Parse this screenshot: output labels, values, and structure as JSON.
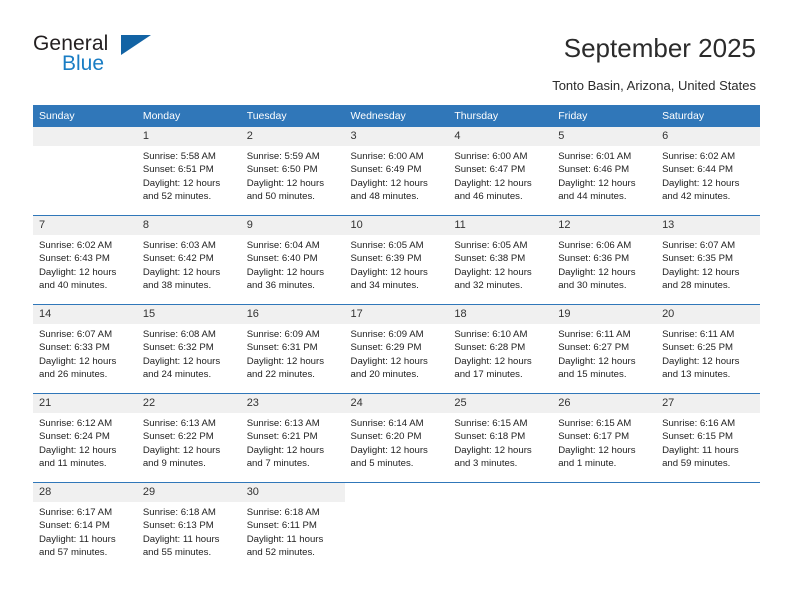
{
  "brand": {
    "name_top": "General",
    "name_bottom": "Blue",
    "triangle_color": "#1263a4",
    "blue": "#1a7dc4"
  },
  "header": {
    "title": "September 2025",
    "subtitle": "Tonto Basin, Arizona, United States"
  },
  "theme": {
    "header_row_bg": "#3077b9",
    "daynum_bg": "#f0f0f0",
    "grid_line": "#3077b9"
  },
  "weekday_headers": [
    "Sunday",
    "Monday",
    "Tuesday",
    "Wednesday",
    "Thursday",
    "Friday",
    "Saturday"
  ],
  "weeks": [
    [
      {
        "day": "",
        "blank": true,
        "sunrise": "",
        "sunset": "",
        "daylight1": "",
        "daylight2": ""
      },
      {
        "day": "1",
        "sunrise": "Sunrise: 5:58 AM",
        "sunset": "Sunset: 6:51 PM",
        "daylight1": "Daylight: 12 hours",
        "daylight2": "and 52 minutes."
      },
      {
        "day": "2",
        "sunrise": "Sunrise: 5:59 AM",
        "sunset": "Sunset: 6:50 PM",
        "daylight1": "Daylight: 12 hours",
        "daylight2": "and 50 minutes."
      },
      {
        "day": "3",
        "sunrise": "Sunrise: 6:00 AM",
        "sunset": "Sunset: 6:49 PM",
        "daylight1": "Daylight: 12 hours",
        "daylight2": "and 48 minutes."
      },
      {
        "day": "4",
        "sunrise": "Sunrise: 6:00 AM",
        "sunset": "Sunset: 6:47 PM",
        "daylight1": "Daylight: 12 hours",
        "daylight2": "and 46 minutes."
      },
      {
        "day": "5",
        "sunrise": "Sunrise: 6:01 AM",
        "sunset": "Sunset: 6:46 PM",
        "daylight1": "Daylight: 12 hours",
        "daylight2": "and 44 minutes."
      },
      {
        "day": "6",
        "sunrise": "Sunrise: 6:02 AM",
        "sunset": "Sunset: 6:44 PM",
        "daylight1": "Daylight: 12 hours",
        "daylight2": "and 42 minutes."
      }
    ],
    [
      {
        "day": "7",
        "sunrise": "Sunrise: 6:02 AM",
        "sunset": "Sunset: 6:43 PM",
        "daylight1": "Daylight: 12 hours",
        "daylight2": "and 40 minutes."
      },
      {
        "day": "8",
        "sunrise": "Sunrise: 6:03 AM",
        "sunset": "Sunset: 6:42 PM",
        "daylight1": "Daylight: 12 hours",
        "daylight2": "and 38 minutes."
      },
      {
        "day": "9",
        "sunrise": "Sunrise: 6:04 AM",
        "sunset": "Sunset: 6:40 PM",
        "daylight1": "Daylight: 12 hours",
        "daylight2": "and 36 minutes."
      },
      {
        "day": "10",
        "sunrise": "Sunrise: 6:05 AM",
        "sunset": "Sunset: 6:39 PM",
        "daylight1": "Daylight: 12 hours",
        "daylight2": "and 34 minutes."
      },
      {
        "day": "11",
        "sunrise": "Sunrise: 6:05 AM",
        "sunset": "Sunset: 6:38 PM",
        "daylight1": "Daylight: 12 hours",
        "daylight2": "and 32 minutes."
      },
      {
        "day": "12",
        "sunrise": "Sunrise: 6:06 AM",
        "sunset": "Sunset: 6:36 PM",
        "daylight1": "Daylight: 12 hours",
        "daylight2": "and 30 minutes."
      },
      {
        "day": "13",
        "sunrise": "Sunrise: 6:07 AM",
        "sunset": "Sunset: 6:35 PM",
        "daylight1": "Daylight: 12 hours",
        "daylight2": "and 28 minutes."
      }
    ],
    [
      {
        "day": "14",
        "sunrise": "Sunrise: 6:07 AM",
        "sunset": "Sunset: 6:33 PM",
        "daylight1": "Daylight: 12 hours",
        "daylight2": "and 26 minutes."
      },
      {
        "day": "15",
        "sunrise": "Sunrise: 6:08 AM",
        "sunset": "Sunset: 6:32 PM",
        "daylight1": "Daylight: 12 hours",
        "daylight2": "and 24 minutes."
      },
      {
        "day": "16",
        "sunrise": "Sunrise: 6:09 AM",
        "sunset": "Sunset: 6:31 PM",
        "daylight1": "Daylight: 12 hours",
        "daylight2": "and 22 minutes."
      },
      {
        "day": "17",
        "sunrise": "Sunrise: 6:09 AM",
        "sunset": "Sunset: 6:29 PM",
        "daylight1": "Daylight: 12 hours",
        "daylight2": "and 20 minutes."
      },
      {
        "day": "18",
        "sunrise": "Sunrise: 6:10 AM",
        "sunset": "Sunset: 6:28 PM",
        "daylight1": "Daylight: 12 hours",
        "daylight2": "and 17 minutes."
      },
      {
        "day": "19",
        "sunrise": "Sunrise: 6:11 AM",
        "sunset": "Sunset: 6:27 PM",
        "daylight1": "Daylight: 12 hours",
        "daylight2": "and 15 minutes."
      },
      {
        "day": "20",
        "sunrise": "Sunrise: 6:11 AM",
        "sunset": "Sunset: 6:25 PM",
        "daylight1": "Daylight: 12 hours",
        "daylight2": "and 13 minutes."
      }
    ],
    [
      {
        "day": "21",
        "sunrise": "Sunrise: 6:12 AM",
        "sunset": "Sunset: 6:24 PM",
        "daylight1": "Daylight: 12 hours",
        "daylight2": "and 11 minutes."
      },
      {
        "day": "22",
        "sunrise": "Sunrise: 6:13 AM",
        "sunset": "Sunset: 6:22 PM",
        "daylight1": "Daylight: 12 hours",
        "daylight2": "and 9 minutes."
      },
      {
        "day": "23",
        "sunrise": "Sunrise: 6:13 AM",
        "sunset": "Sunset: 6:21 PM",
        "daylight1": "Daylight: 12 hours",
        "daylight2": "and 7 minutes."
      },
      {
        "day": "24",
        "sunrise": "Sunrise: 6:14 AM",
        "sunset": "Sunset: 6:20 PM",
        "daylight1": "Daylight: 12 hours",
        "daylight2": "and 5 minutes."
      },
      {
        "day": "25",
        "sunrise": "Sunrise: 6:15 AM",
        "sunset": "Sunset: 6:18 PM",
        "daylight1": "Daylight: 12 hours",
        "daylight2": "and 3 minutes."
      },
      {
        "day": "26",
        "sunrise": "Sunrise: 6:15 AM",
        "sunset": "Sunset: 6:17 PM",
        "daylight1": "Daylight: 12 hours",
        "daylight2": "and 1 minute."
      },
      {
        "day": "27",
        "sunrise": "Sunrise: 6:16 AM",
        "sunset": "Sunset: 6:15 PM",
        "daylight1": "Daylight: 11 hours",
        "daylight2": "and 59 minutes."
      }
    ],
    [
      {
        "day": "28",
        "sunrise": "Sunrise: 6:17 AM",
        "sunset": "Sunset: 6:14 PM",
        "daylight1": "Daylight: 11 hours",
        "daylight2": "and 57 minutes."
      },
      {
        "day": "29",
        "sunrise": "Sunrise: 6:18 AM",
        "sunset": "Sunset: 6:13 PM",
        "daylight1": "Daylight: 11 hours",
        "daylight2": "and 55 minutes."
      },
      {
        "day": "30",
        "sunrise": "Sunrise: 6:18 AM",
        "sunset": "Sunset: 6:11 PM",
        "daylight1": "Daylight: 11 hours",
        "daylight2": "and 52 minutes."
      },
      {
        "day": "",
        "blank": true,
        "sunrise": "",
        "sunset": "",
        "daylight1": "",
        "daylight2": ""
      },
      {
        "day": "",
        "blank": true,
        "sunrise": "",
        "sunset": "",
        "daylight1": "",
        "daylight2": ""
      },
      {
        "day": "",
        "blank": true,
        "sunrise": "",
        "sunset": "",
        "daylight1": "",
        "daylight2": ""
      },
      {
        "day": "",
        "blank": true,
        "sunrise": "",
        "sunset": "",
        "daylight1": "",
        "daylight2": ""
      }
    ]
  ]
}
